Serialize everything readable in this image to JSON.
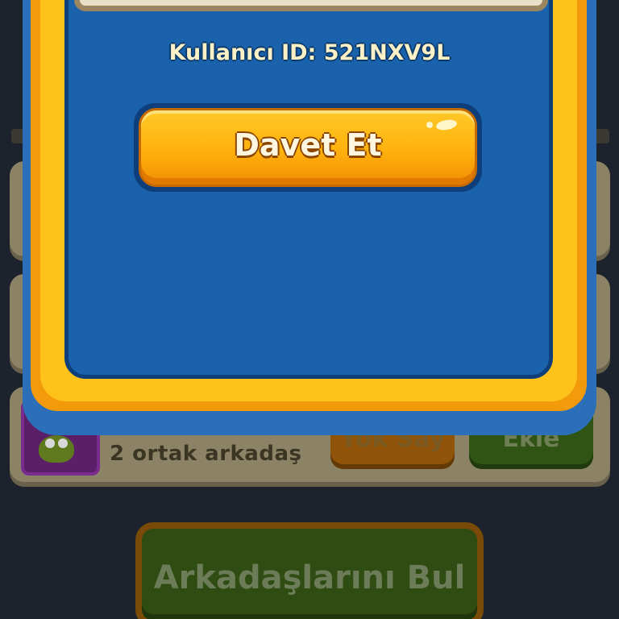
{
  "background": {
    "mutual_friends_text": "2 ortak arkadaş",
    "ignore_button_label": "Yok Say",
    "add_button_label": "Ekle",
    "find_friends_button_label": "Arkadaşlarını Bul"
  },
  "modal": {
    "user_id_text": "Kullanıcı ID: 521NXV9L",
    "invite_button_label": "Davet Et"
  },
  "colors": {
    "modal_panel": "#1b62ac",
    "modal_frame": "#f39a0a",
    "invite_button": "#ffb10d"
  }
}
